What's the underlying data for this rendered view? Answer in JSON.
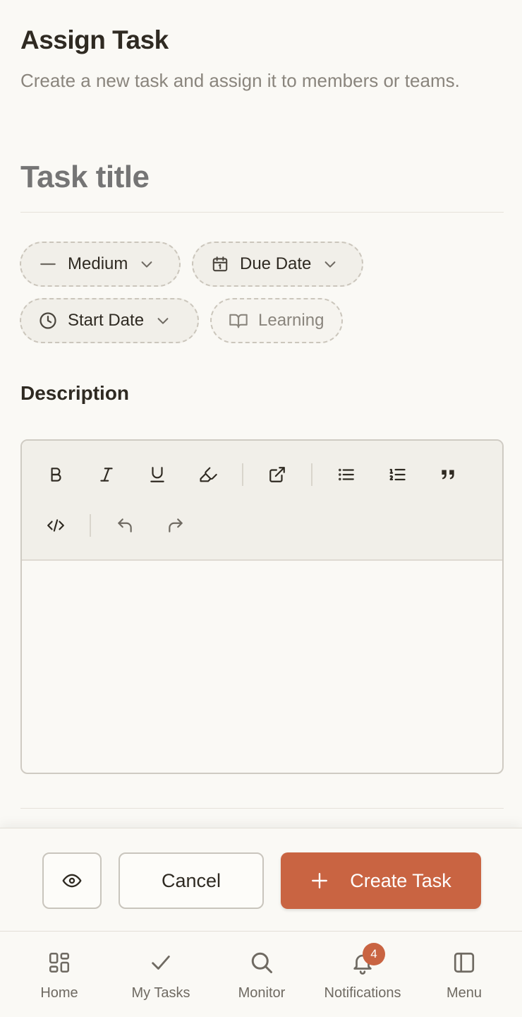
{
  "header": {
    "title": "Assign Task",
    "subtitle": "Create a new task and assign it to members or teams."
  },
  "form": {
    "task_title_placeholder": "Task title",
    "chips": {
      "priority": "Medium",
      "due_date": "Due Date",
      "start_date": "Start Date",
      "category": "Learning"
    },
    "description_label": "Description",
    "editor": {
      "toolbar": [
        "bold-icon",
        "italic-icon",
        "underline-icon",
        "highlight-icon",
        "link-icon",
        "bullet-list-icon",
        "ordered-list-icon",
        "quote-icon",
        "code-icon",
        "undo-icon",
        "redo-icon"
      ],
      "content": ""
    }
  },
  "actions": {
    "preview_icon": "eye-icon",
    "cancel_label": "Cancel",
    "create_label": "Create Task"
  },
  "tabs": [
    {
      "label": "Home",
      "icon": "home-grid-icon"
    },
    {
      "label": "My Tasks",
      "icon": "check-icon"
    },
    {
      "label": "Monitor",
      "icon": "search-icon"
    },
    {
      "label": "Notifications",
      "icon": "bell-icon",
      "badge": "4"
    },
    {
      "label": "Menu",
      "icon": "sidebar-panel-icon"
    }
  ],
  "colors": {
    "accent": "#c96442",
    "background": "#faf9f5",
    "text": "#2f2a22",
    "muted": "#8a857d"
  }
}
